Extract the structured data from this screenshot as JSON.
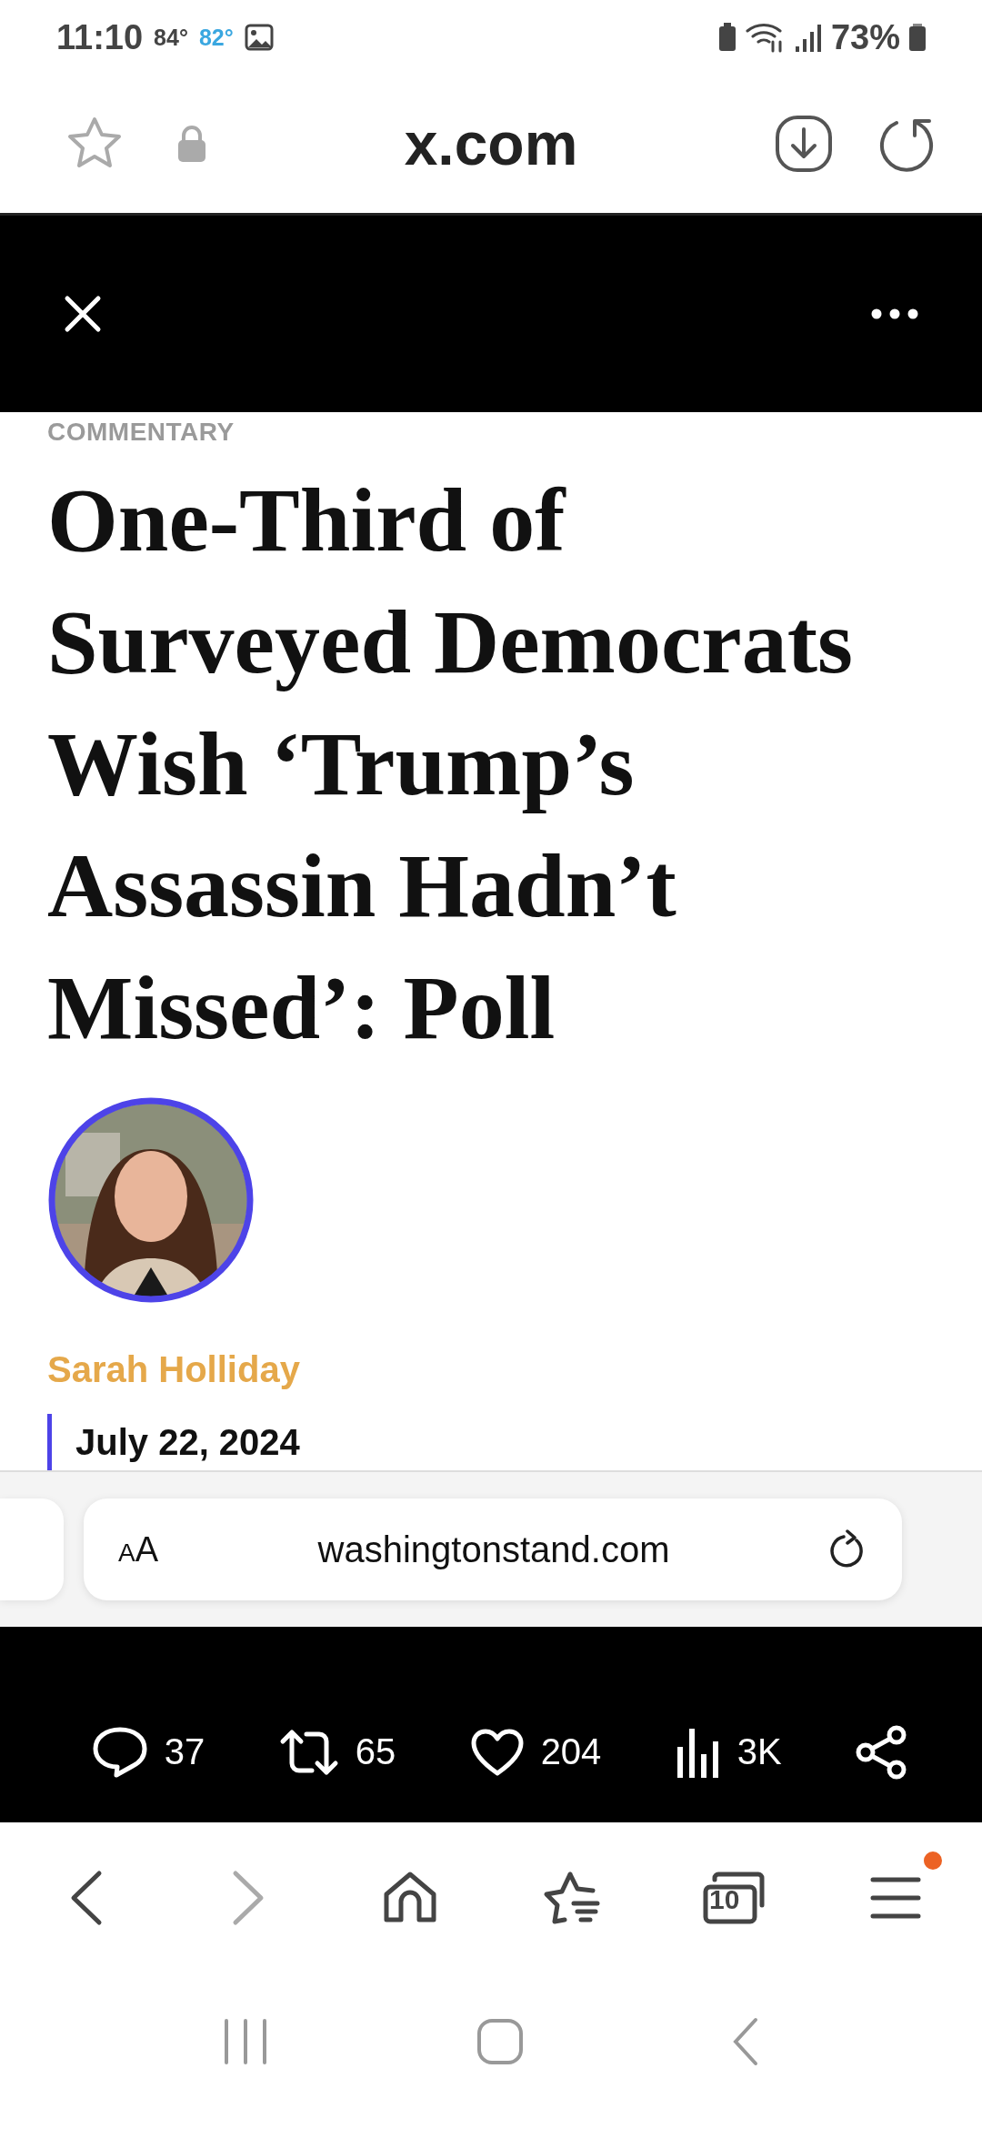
{
  "status_bar": {
    "time": "11:10",
    "temp_high": "84°",
    "temp_low": "82°",
    "battery": "73%"
  },
  "browser_top": {
    "title": "x.com"
  },
  "article": {
    "category": "COMMENTARY",
    "headline": "One-Third of Surveyed Democrats Wish ‘Trump’s Assassin Hadn’t Missed’: Poll",
    "author": "Sarah Holliday",
    "date": "July 22, 2024"
  },
  "address_bar": {
    "text_size": "AA",
    "url": "washingtonstand.com"
  },
  "post_actions": [
    {
      "kind": "reply",
      "count": "37"
    },
    {
      "kind": "repost",
      "count": "65"
    },
    {
      "kind": "like",
      "count": "204"
    },
    {
      "kind": "views",
      "count": "3K"
    },
    {
      "kind": "share"
    }
  ],
  "bottom_nav": [
    {
      "kind": "back",
      "disabled": false
    },
    {
      "kind": "forward",
      "disabled": true
    },
    {
      "kind": "home",
      "disabled": false
    },
    {
      "kind": "bookmarks",
      "disabled": false
    },
    {
      "kind": "tabs",
      "disabled": false,
      "count": "10"
    },
    {
      "kind": "menu",
      "disabled": false,
      "badge": true
    }
  ]
}
